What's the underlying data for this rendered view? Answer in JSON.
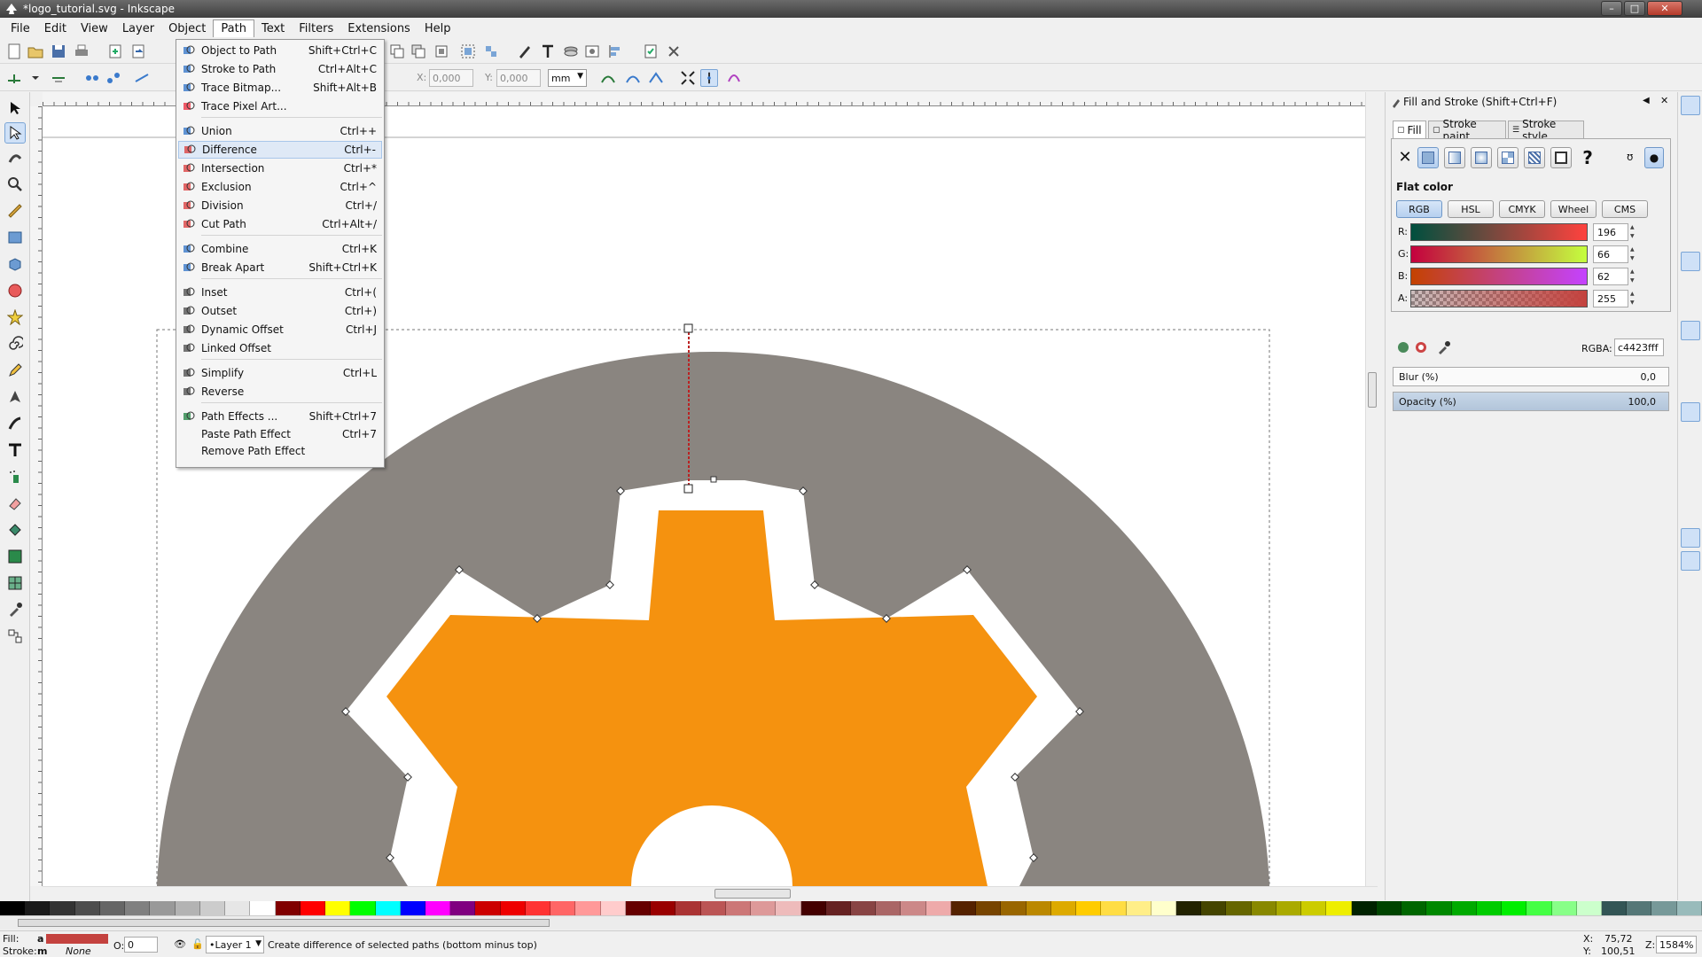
{
  "window": {
    "title": "*logo_tutorial.svg - Inkscape",
    "minimize": "–",
    "maximize": "□",
    "close": "✕"
  },
  "menubar": [
    "File",
    "Edit",
    "View",
    "Layer",
    "Object",
    "Path",
    "Text",
    "Filters",
    "Extensions",
    "Help"
  ],
  "controls": {
    "x_label": "X:",
    "x_value": "0,000",
    "y_label": "Y:",
    "y_value": "0,000",
    "unit": "mm"
  },
  "path_menu": [
    {
      "label": "Object to Path",
      "shortcut": "Shift+Ctrl+C"
    },
    {
      "label": "Stroke to Path",
      "shortcut": "Ctrl+Alt+C"
    },
    {
      "label": "Trace Bitmap...",
      "shortcut": "Shift+Alt+B"
    },
    {
      "label": "Trace Pixel Art...",
      "shortcut": ""
    },
    {
      "label": "Union",
      "shortcut": "Ctrl++"
    },
    {
      "label": "Difference",
      "shortcut": "Ctrl+-"
    },
    {
      "label": "Intersection",
      "shortcut": "Ctrl+*"
    },
    {
      "label": "Exclusion",
      "shortcut": "Ctrl+^"
    },
    {
      "label": "Division",
      "shortcut": "Ctrl+/"
    },
    {
      "label": "Cut Path",
      "shortcut": "Ctrl+Alt+/"
    },
    {
      "label": "Combine",
      "shortcut": "Ctrl+K"
    },
    {
      "label": "Break Apart",
      "shortcut": "Shift+Ctrl+K"
    },
    {
      "label": "Inset",
      "shortcut": "Ctrl+("
    },
    {
      "label": "Outset",
      "shortcut": "Ctrl+)"
    },
    {
      "label": "Dynamic Offset",
      "shortcut": "Ctrl+J"
    },
    {
      "label": "Linked Offset",
      "shortcut": ""
    },
    {
      "label": "Simplify",
      "shortcut": "Ctrl+L"
    },
    {
      "label": "Reverse",
      "shortcut": ""
    },
    {
      "label": "Path Effects ...",
      "shortcut": "Shift+Ctrl+7"
    },
    {
      "label": "Paste Path Effect",
      "shortcut": "Ctrl+7"
    },
    {
      "label": "Remove Path Effect",
      "shortcut": ""
    }
  ],
  "fill_stroke": {
    "title": "Fill and Stroke (Shift+Ctrl+F)",
    "tabs": [
      "Fill",
      "Stroke paint",
      "Stroke style"
    ],
    "mode_label": "Flat color",
    "modes": [
      "RGB",
      "HSL",
      "CMYK",
      "Wheel",
      "CMS"
    ],
    "channels": [
      {
        "label": "R:",
        "value": "196"
      },
      {
        "label": "G:",
        "value": "66"
      },
      {
        "label": "B:",
        "value": "62"
      },
      {
        "label": "A:",
        "value": "255"
      }
    ],
    "rgba_label": "RGBA:",
    "rgba_value": "c4423fff",
    "blur_label": "Blur (%)",
    "blur_value": "0,0",
    "opacity_label": "Opacity (%)",
    "opacity_value": "100,0",
    "unknown_paint": "?"
  },
  "colors": {
    "gear_gray": "#8a8580",
    "gear_orange": "#f5920f",
    "fill_swatch": "#c4423f"
  },
  "status": {
    "fill_label": "Fill:",
    "fill_a": "a",
    "stroke_label": "Stroke:",
    "stroke_m": "m",
    "stroke_value": "None",
    "opacity_label": "O:",
    "opacity_value": "0",
    "layer": "•Layer 1",
    "message": "Create difference of selected paths (bottom minus top)",
    "x_label": "X:",
    "x_value": "75,72",
    "y_label": "Y:",
    "y_value": "100,51",
    "zoom_label": "Z:",
    "zoom_value": "1584%"
  }
}
